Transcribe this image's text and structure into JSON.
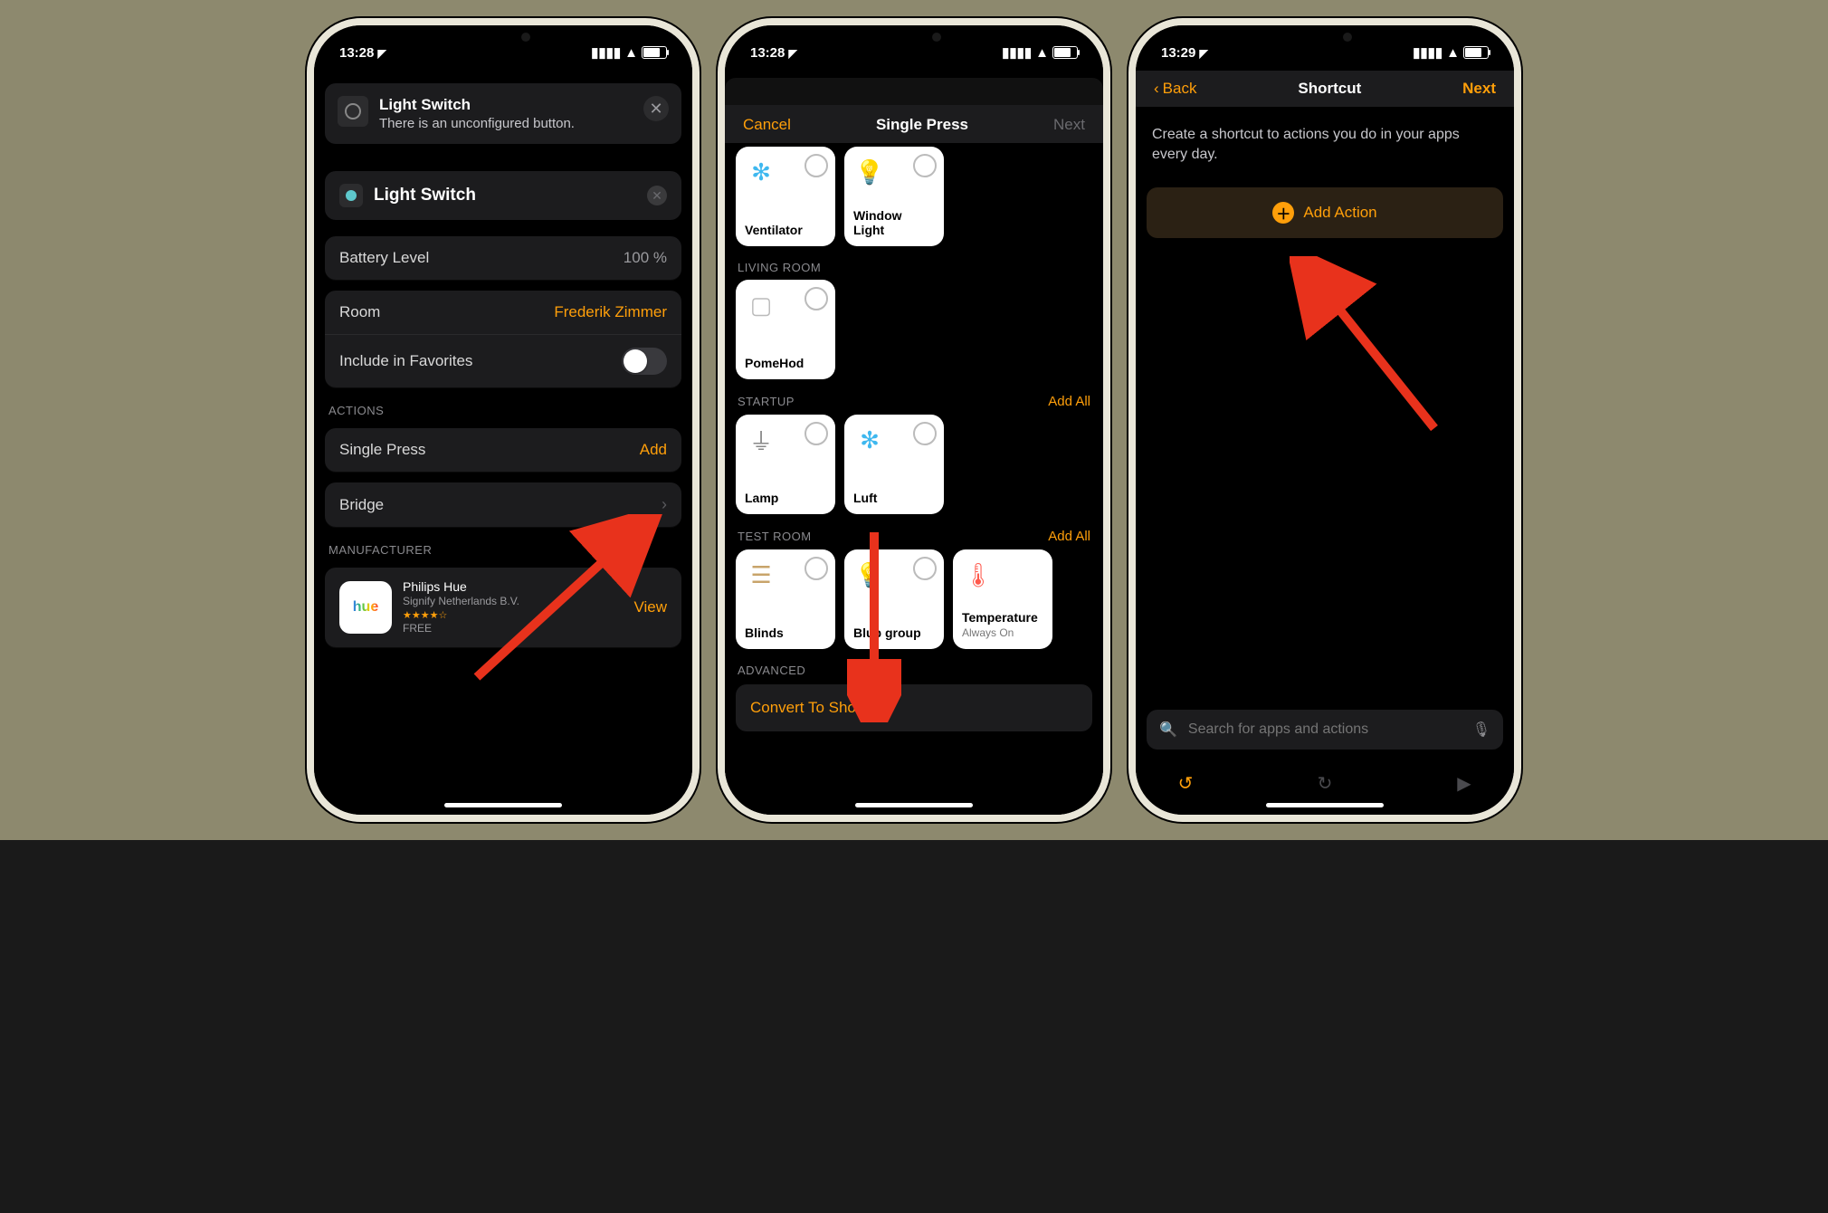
{
  "accent": "#ff9f0a",
  "phone1": {
    "time": "13:28",
    "banner": {
      "title": "Light Switch",
      "subtitle": "There is an unconfigured button."
    },
    "accessory": {
      "name": "Light Switch"
    },
    "batteryLevel": {
      "label": "Battery Level",
      "value": "100 %"
    },
    "room": {
      "label": "Room",
      "value": "Frederik Zimmer"
    },
    "favorites": {
      "label": "Include in Favorites"
    },
    "actionsHeader": "ACTIONS",
    "singlePress": {
      "label": "Single Press",
      "action": "Add"
    },
    "bridge": {
      "label": "Bridge"
    },
    "manufacturerHeader": "MANUFACTURER",
    "manufacturer": {
      "name": "Philips Hue",
      "company": "Signify Netherlands B.V.",
      "price": "FREE",
      "view": "View"
    }
  },
  "phone2": {
    "time": "13:28",
    "header": {
      "cancel": "Cancel",
      "title": "Single Press",
      "next": "Next"
    },
    "tilesTop": [
      {
        "name": "Ventilator"
      },
      {
        "name": "Window Light"
      }
    ],
    "sections": [
      {
        "name": "LIVING ROOM",
        "addAll": null,
        "items": [
          {
            "name": "PomeHod"
          }
        ]
      },
      {
        "name": "STARTUP",
        "addAll": "Add All",
        "items": [
          {
            "name": "Lamp"
          },
          {
            "name": "Luft"
          }
        ]
      },
      {
        "name": "TEST ROOM",
        "addAll": "Add All",
        "items": [
          {
            "name": "Blinds"
          },
          {
            "name": "Blub group"
          },
          {
            "name": "Temperature",
            "sub": "Always On"
          }
        ]
      }
    ],
    "advancedHeader": "ADVANCED",
    "convert": "Convert To Shortcut"
  },
  "phone3": {
    "time": "13:29",
    "header": {
      "back": "Back",
      "title": "Shortcut",
      "next": "Next"
    },
    "description": "Create a shortcut to actions you do in your apps every day.",
    "addAction": "Add Action",
    "searchPlaceholder": "Search for apps and actions"
  }
}
